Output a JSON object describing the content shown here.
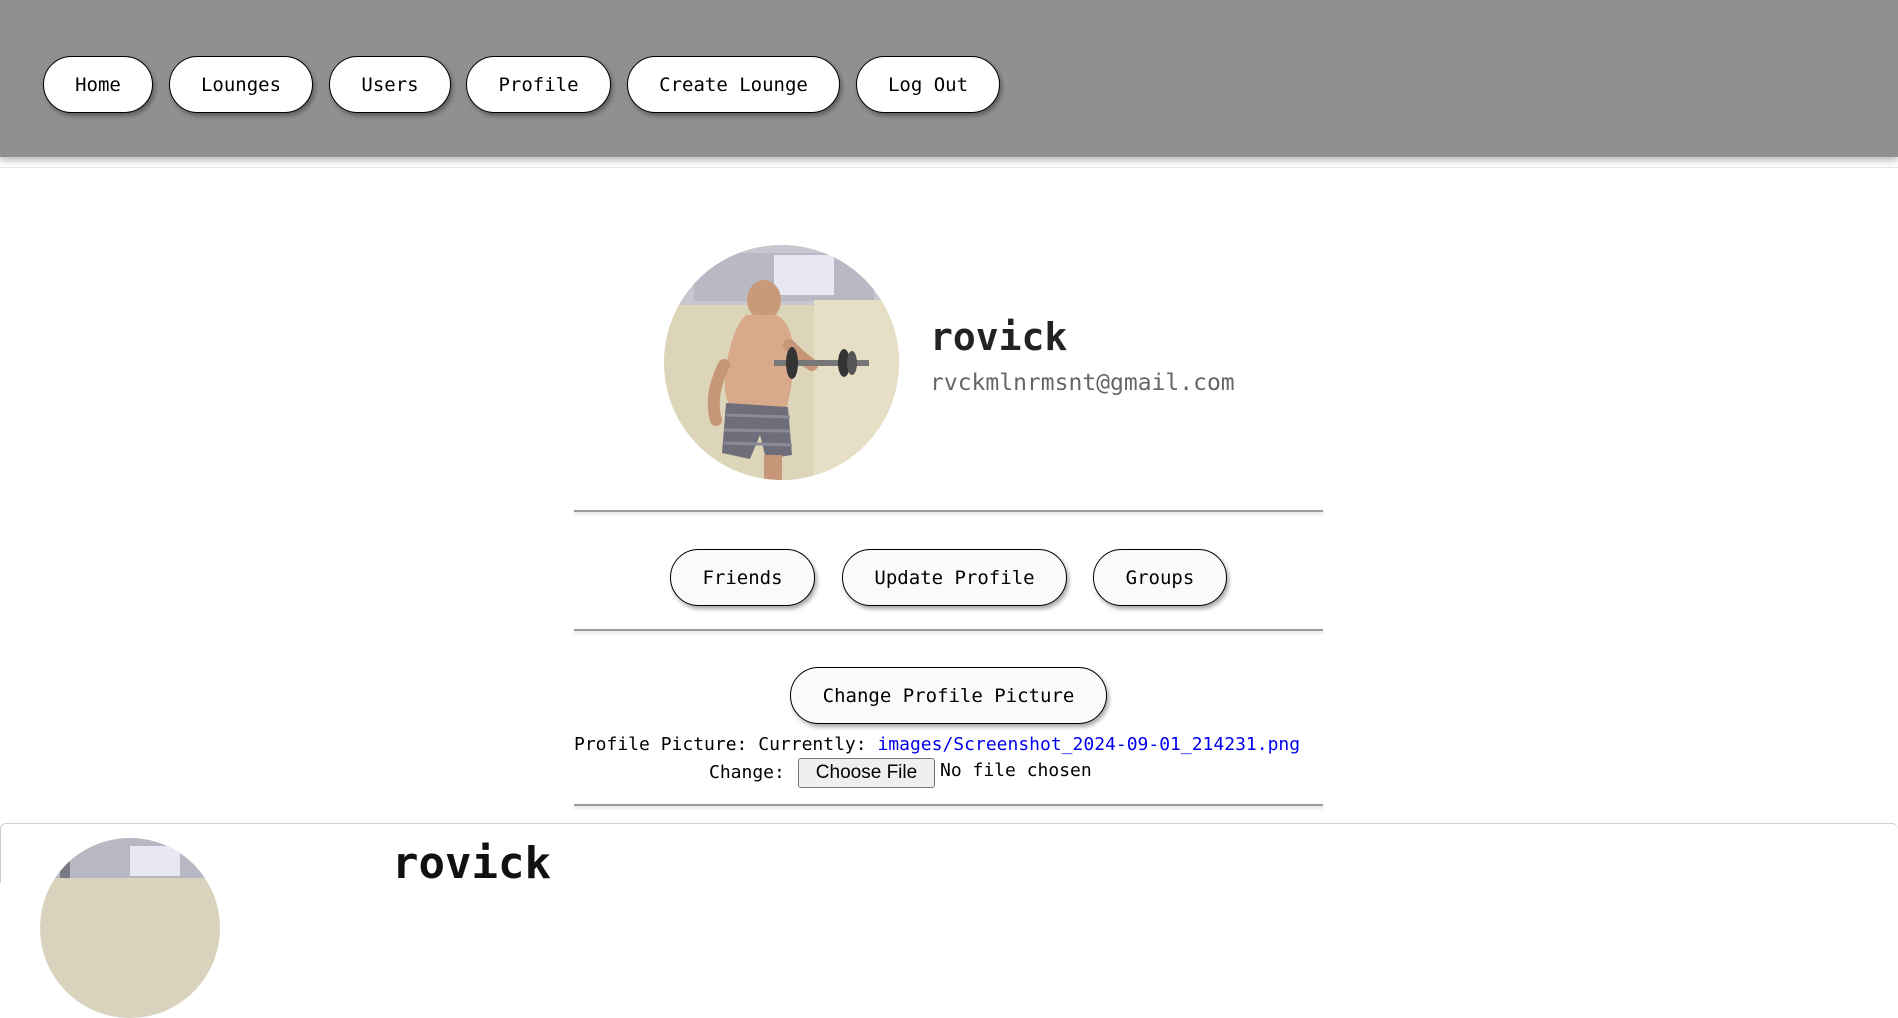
{
  "nav": {
    "home": "Home",
    "lounges": "Lounges",
    "users": "Users",
    "profile": "Profile",
    "create_lounge": "Create Lounge",
    "log_out": "Log Out"
  },
  "profile": {
    "username": "rovick",
    "email": "rvckmlnrmsnt@gmail.com",
    "avatar_icon": "profile-photo"
  },
  "actions": {
    "friends": "Friends",
    "update_profile": "Update Profile",
    "groups": "Groups"
  },
  "picture_form": {
    "submit_label": "Change Profile Picture",
    "field_label": "Profile Picture:",
    "currently_label": "Currently:",
    "current_path": "images/Screenshot_2024-09-01_214231.png",
    "change_label": "Change:",
    "choose_file_label": "Choose File",
    "no_file_text": "No file chosen"
  },
  "bottom_card": {
    "username": "rovick"
  },
  "colors": {
    "topbar": "#918f90",
    "link": "#0000ee"
  }
}
